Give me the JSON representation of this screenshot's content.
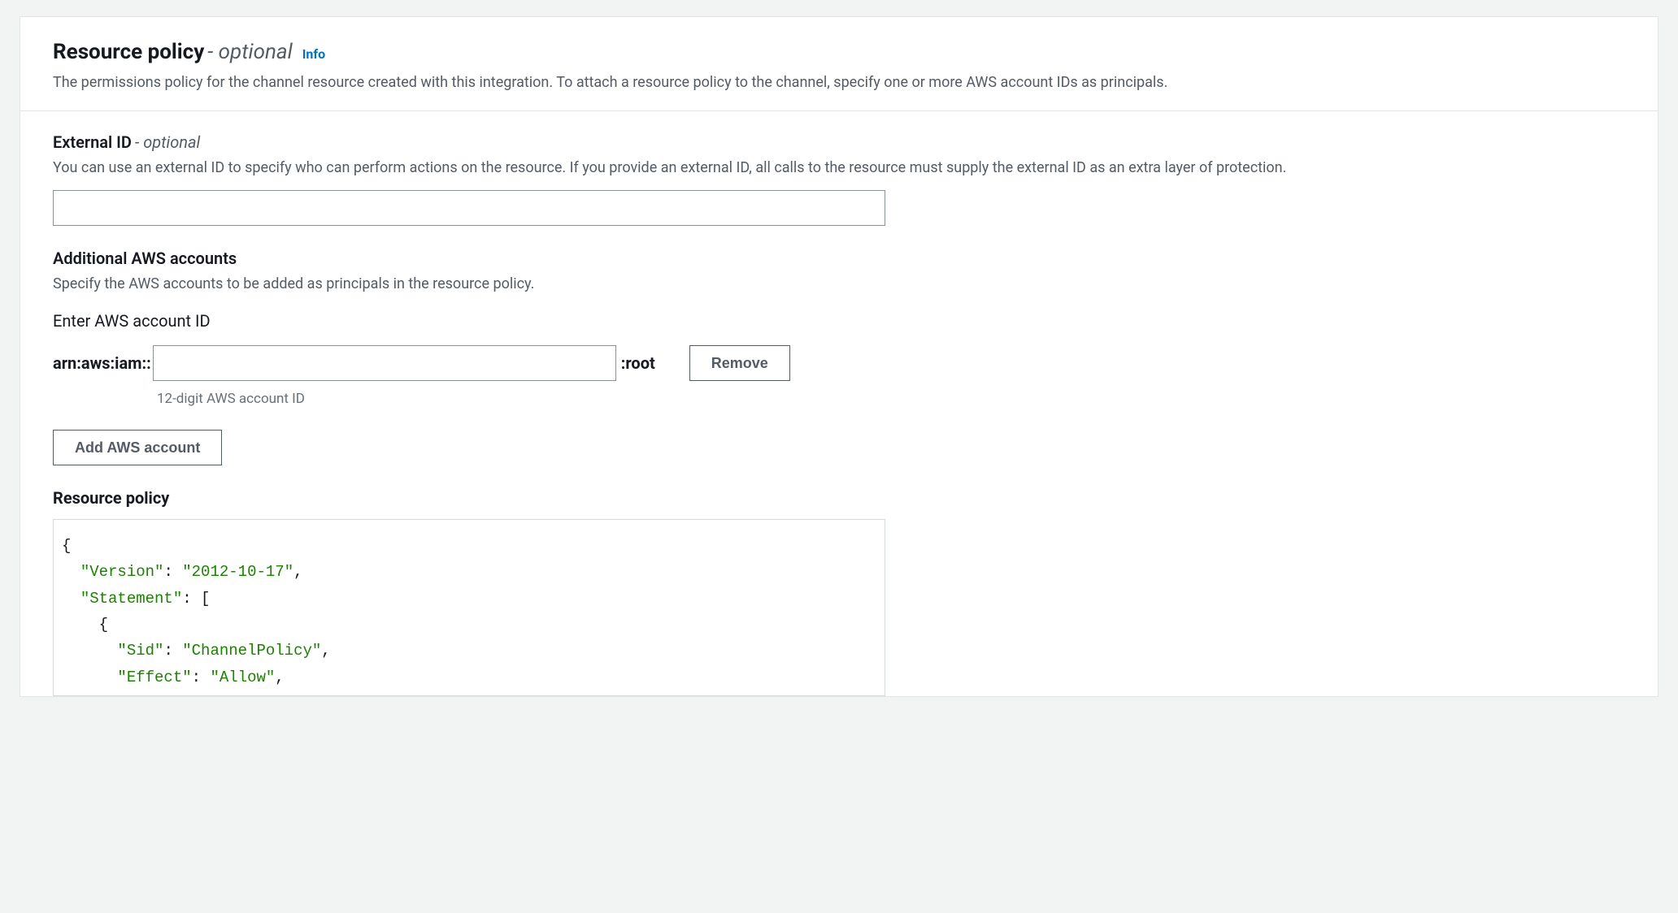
{
  "header": {
    "title": "Resource policy",
    "optional": "optional",
    "info": "Info",
    "description": "The permissions policy for the channel resource created with this integration. To attach a resource policy to the channel, specify one or more AWS account IDs as principals."
  },
  "externalId": {
    "label": "External ID",
    "optional": "optional",
    "description": "You can use an external ID to specify who can perform actions on the resource. If you provide an external ID, all calls to the resource must supply the external ID as an extra layer of protection.",
    "value": ""
  },
  "additionalAccounts": {
    "label": "Additional AWS accounts",
    "description": "Specify the AWS accounts to be added as principals in the resource policy.",
    "enterLabel": "Enter AWS account ID",
    "arnPrefix": "arn:aws:iam::",
    "arnSuffix": ":root",
    "accountValue": "",
    "hint": "12-digit AWS account ID",
    "removeLabel": "Remove",
    "addLabel": "Add AWS account"
  },
  "policy": {
    "label": "Resource policy",
    "code": {
      "version": "2012-10-17",
      "sid": "ChannelPolicy",
      "effect": "Allow"
    }
  }
}
